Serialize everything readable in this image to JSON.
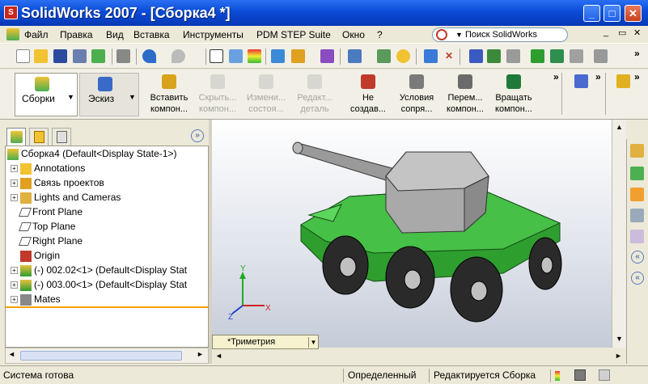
{
  "window": {
    "title": "SolidWorks 2007 - [Сборка4 *]",
    "minimize": "_",
    "maximize": "□",
    "close": "✕"
  },
  "menubar": {
    "items": [
      "Файл",
      "Правка",
      "Вид",
      "Вставка",
      "Инструменты",
      "PDM STEP Suite",
      "Окно",
      "?"
    ],
    "search_text": "Поиск SolidWorks",
    "doc_minimize": "_",
    "doc_restore": "▭",
    "doc_close": "✕"
  },
  "command_manager": {
    "sketch_mode": [
      "Сборки",
      "Эскиз"
    ],
    "commands": [
      {
        "line1": "Вставить",
        "line2": "компон...",
        "enabled": true,
        "color": "#d9a21b"
      },
      {
        "line1": "Скрыть...",
        "line2": "компон...",
        "enabled": false,
        "color": "#b0b0b0"
      },
      {
        "line1": "Измени...",
        "line2": "состоя...",
        "enabled": false,
        "color": "#b0b0b0"
      },
      {
        "line1": "Редакт...",
        "line2": "деталь",
        "enabled": false,
        "color": "#b0b0b0"
      },
      {
        "line1": "Не",
        "line2": "создав...",
        "enabled": true,
        "color": "#c0392b"
      },
      {
        "line1": "Условия",
        "line2": "сопря...",
        "enabled": true,
        "color": "#7a7a7a"
      },
      {
        "line1": "Перем...",
        "line2": "компон...",
        "enabled": true,
        "color": "#6b6b6b"
      },
      {
        "line1": "Вращать",
        "line2": "компон...",
        "enabled": true,
        "color": "#1f7a3a"
      }
    ]
  },
  "feature_tree": {
    "rows": [
      {
        "label": "Сборка4  (Default<Display State-1>)",
        "icon": "assembly-icon",
        "expander": ""
      },
      {
        "label": "Annotations",
        "icon": "annotations-icon",
        "expander": "+"
      },
      {
        "label": "Связь проектов",
        "icon": "design-link-icon",
        "expander": "+"
      },
      {
        "label": "Lights and Cameras",
        "icon": "lights-icon",
        "expander": "+"
      },
      {
        "label": "Front Plane",
        "icon": "plane-icon",
        "expander": ""
      },
      {
        "label": "Top Plane",
        "icon": "plane-icon",
        "expander": ""
      },
      {
        "label": "Right Plane",
        "icon": "plane-icon",
        "expander": ""
      },
      {
        "label": "Origin",
        "icon": "origin-icon",
        "expander": ""
      },
      {
        "label": "(-) 002.02<1> (Default<Display Stat",
        "icon": "part-icon",
        "expander": "+"
      },
      {
        "label": "(-) 003.00<1> (Default<Display Stat",
        "icon": "part-icon",
        "expander": "+"
      },
      {
        "label": "Mates",
        "icon": "mates-icon",
        "expander": "+"
      }
    ]
  },
  "viewport": {
    "view_name": "*Триметрия",
    "axis_labels": {
      "x": "X",
      "y": "Y",
      "z": "Z"
    },
    "model_color": "#2e9e2e",
    "turret_color": "#a9a9a9"
  },
  "statusbar": {
    "status": "Система готова",
    "state": "Определенный",
    "mode": "Редактируется Сборка"
  }
}
